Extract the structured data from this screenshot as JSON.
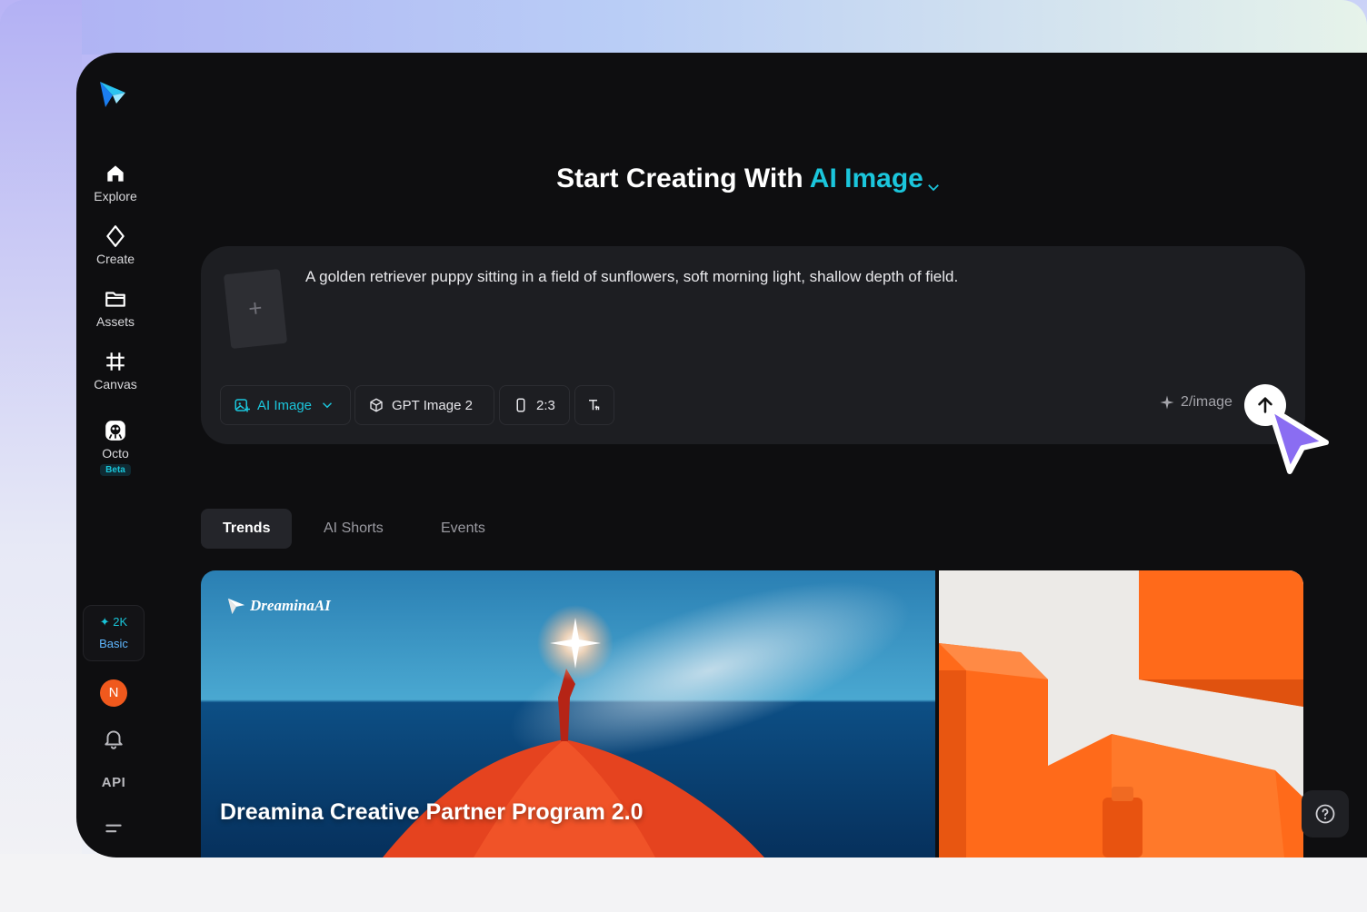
{
  "header": {
    "title_prefix": "Start Creating With",
    "title_mode": "AI Image"
  },
  "sidebar": {
    "items": [
      {
        "label": "Explore",
        "icon": "home-icon"
      },
      {
        "label": "Create",
        "icon": "sparkle-diamond-icon"
      },
      {
        "label": "Assets",
        "icon": "folder-icon"
      },
      {
        "label": "Canvas",
        "icon": "canvas-grid-icon"
      },
      {
        "label": "Octo",
        "icon": "octo-icon",
        "badge": "Beta"
      }
    ],
    "credits": "2K",
    "plan": "Basic",
    "avatar_initial": "N",
    "api_label": "API"
  },
  "prompt": {
    "text": "A golden retriever puppy sitting in a field of sunflowers, soft morning light, shallow depth of field.",
    "mode_label": "AI Image",
    "model_label": "GPT Image 2",
    "ratio_label": "2:3",
    "cost_label": "2/image"
  },
  "tabs": [
    {
      "label": "Trends",
      "active": true
    },
    {
      "label": "AI Shorts",
      "active": false
    },
    {
      "label": "Events",
      "active": false
    }
  ],
  "cards": {
    "main_title": "Dreamina Creative Partner Program 2.0",
    "brand": "DreaminaAI"
  },
  "colors": {
    "accent": "#1bc6dc",
    "background": "#0e0e10",
    "card": "#1d1e22",
    "avatar": "#f0591d"
  }
}
